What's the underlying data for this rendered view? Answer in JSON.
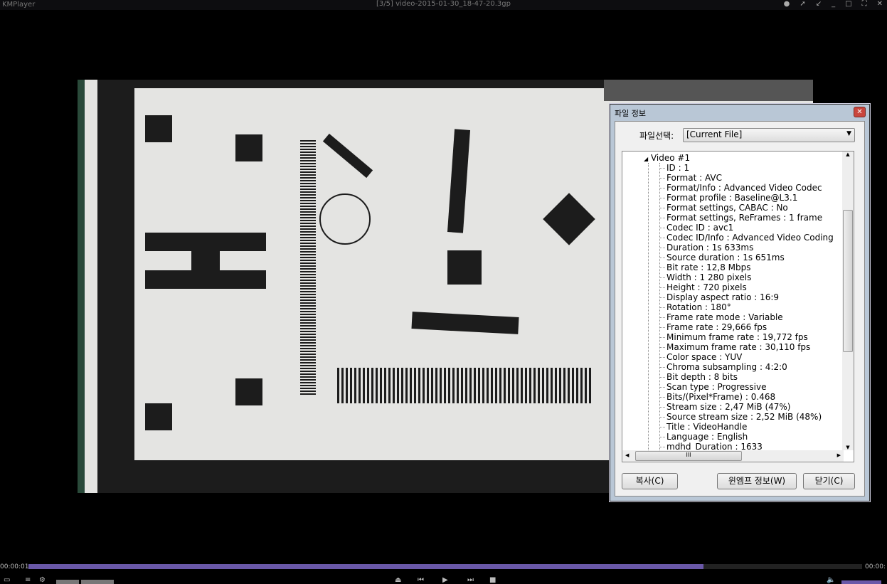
{
  "app": {
    "name": "KMPlayer",
    "title": "[3/5] video-2015-01-30_18-47-20.3gp"
  },
  "player": {
    "time_current": "00:00:01",
    "time_total": "00:00:",
    "progress_percent": 81
  },
  "dialog": {
    "title": "파일 정보",
    "file_select_label": "파일선택:",
    "file_select_value": "[Current File]",
    "tree_root": "Video #1",
    "items": [
      "ID : 1",
      "Format : AVC",
      "Format/Info : Advanced Video Codec",
      "Format profile : Baseline@L3.1",
      "Format settings, CABAC : No",
      "Format settings, ReFrames : 1 frame",
      "Codec ID : avc1",
      "Codec ID/Info : Advanced Video Coding",
      "Duration : 1s 633ms",
      "Source duration : 1s 651ms",
      "Bit rate : 12,8 Mbps",
      "Width : 1 280 pixels",
      "Height : 720 pixels",
      "Display aspect ratio : 16:9",
      "Rotation : 180°",
      "Frame rate mode : Variable",
      "Frame rate : 29,666 fps",
      "Minimum frame rate : 19,772 fps",
      "Maximum frame rate : 30,110 fps",
      "Color space : YUV",
      "Chroma subsampling : 4:2:0",
      "Bit depth : 8 bits",
      "Scan type : Progressive",
      "Bits/(Pixel*Frame) : 0.468",
      "Stream size : 2,47 MiB (47%)",
      "Source stream size : 2,52 MiB (48%)",
      "Title : VideoHandle",
      "Language : English",
      "mdhd_Duration : 1633"
    ],
    "buttons": {
      "copy": "복사(C)",
      "winamp": "윈엠프 정보(W)",
      "close": "닫기(C)"
    }
  }
}
